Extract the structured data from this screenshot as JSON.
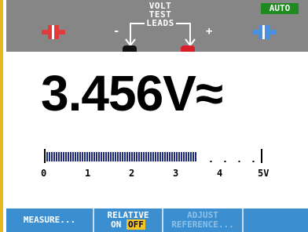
{
  "header": {
    "leads_line1": "VOLT",
    "leads_line2": "TEST",
    "leads_line3": "LEADS",
    "minus": "-",
    "plus": "+",
    "range_mode": "AUTO"
  },
  "reading": {
    "value": "3.456",
    "unit": "V",
    "mode_symbol": "≈"
  },
  "bargraph": {
    "level": 0.691,
    "scale_labels": [
      "0",
      "1",
      "2",
      "3",
      "4",
      "5V"
    ]
  },
  "softkeys": {
    "f1": "MEASURE...",
    "f2_line1": "RELATIVE",
    "f2_on": "ON",
    "f2_off": "OFF",
    "f3_line1": "ADJUST",
    "f3_line2": "REFERENCE..."
  },
  "colors": {
    "header_bg": "#868686",
    "softkey_bg": "#3b8fd1",
    "auto_badge": "#1f8a1f",
    "off_highlight": "#f3c523",
    "frame_accent": "#e8b820"
  }
}
